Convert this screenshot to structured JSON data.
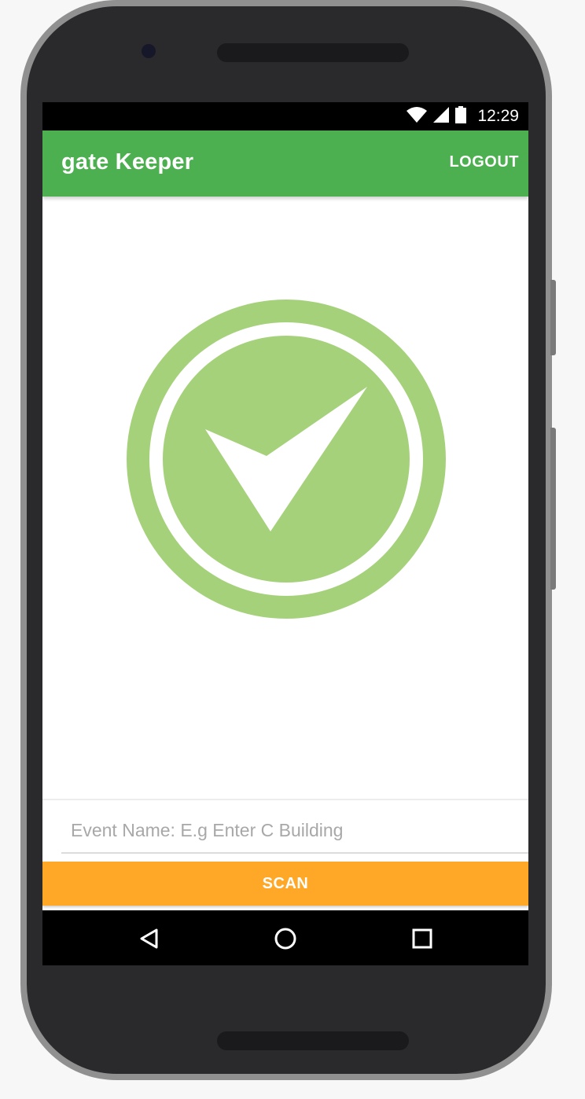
{
  "status_bar": {
    "time": "12:29",
    "icons": [
      "wifi-icon",
      "signal-icon",
      "battery-icon"
    ]
  },
  "app_bar": {
    "title": "gate Keeper",
    "logout_label": "LOGOUT"
  },
  "main": {
    "status_icon": "check-circle-icon"
  },
  "event_input": {
    "value": "",
    "placeholder": "Event Name: E.g Enter C Building"
  },
  "scan_button": {
    "label": "SCAN"
  },
  "nav_bar": {
    "icons": [
      "back-icon",
      "home-icon",
      "recents-icon"
    ]
  },
  "colors": {
    "app_bar": "#4caf50",
    "check_circle": "#a5d17a",
    "scan_button": "#ffa726",
    "status_bar": "#000000"
  }
}
